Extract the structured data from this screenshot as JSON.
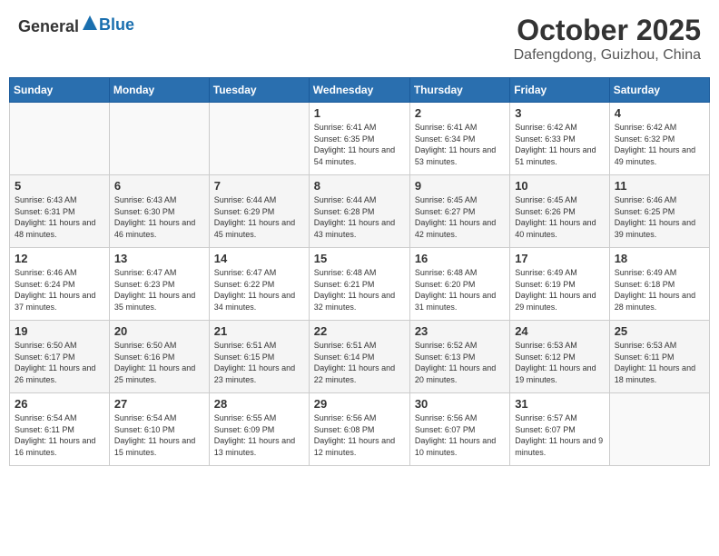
{
  "header": {
    "logo_general": "General",
    "logo_blue": "Blue",
    "month": "October 2025",
    "location": "Dafengdong, Guizhou, China"
  },
  "weekdays": [
    "Sunday",
    "Monday",
    "Tuesday",
    "Wednesday",
    "Thursday",
    "Friday",
    "Saturday"
  ],
  "weeks": [
    [
      {
        "day": "",
        "info": ""
      },
      {
        "day": "",
        "info": ""
      },
      {
        "day": "",
        "info": ""
      },
      {
        "day": "1",
        "info": "Sunrise: 6:41 AM\nSunset: 6:35 PM\nDaylight: 11 hours\nand 54 minutes."
      },
      {
        "day": "2",
        "info": "Sunrise: 6:41 AM\nSunset: 6:34 PM\nDaylight: 11 hours\nand 53 minutes."
      },
      {
        "day": "3",
        "info": "Sunrise: 6:42 AM\nSunset: 6:33 PM\nDaylight: 11 hours\nand 51 minutes."
      },
      {
        "day": "4",
        "info": "Sunrise: 6:42 AM\nSunset: 6:32 PM\nDaylight: 11 hours\nand 49 minutes."
      }
    ],
    [
      {
        "day": "5",
        "info": "Sunrise: 6:43 AM\nSunset: 6:31 PM\nDaylight: 11 hours\nand 48 minutes."
      },
      {
        "day": "6",
        "info": "Sunrise: 6:43 AM\nSunset: 6:30 PM\nDaylight: 11 hours\nand 46 minutes."
      },
      {
        "day": "7",
        "info": "Sunrise: 6:44 AM\nSunset: 6:29 PM\nDaylight: 11 hours\nand 45 minutes."
      },
      {
        "day": "8",
        "info": "Sunrise: 6:44 AM\nSunset: 6:28 PM\nDaylight: 11 hours\nand 43 minutes."
      },
      {
        "day": "9",
        "info": "Sunrise: 6:45 AM\nSunset: 6:27 PM\nDaylight: 11 hours\nand 42 minutes."
      },
      {
        "day": "10",
        "info": "Sunrise: 6:45 AM\nSunset: 6:26 PM\nDaylight: 11 hours\nand 40 minutes."
      },
      {
        "day": "11",
        "info": "Sunrise: 6:46 AM\nSunset: 6:25 PM\nDaylight: 11 hours\nand 39 minutes."
      }
    ],
    [
      {
        "day": "12",
        "info": "Sunrise: 6:46 AM\nSunset: 6:24 PM\nDaylight: 11 hours\nand 37 minutes."
      },
      {
        "day": "13",
        "info": "Sunrise: 6:47 AM\nSunset: 6:23 PM\nDaylight: 11 hours\nand 35 minutes."
      },
      {
        "day": "14",
        "info": "Sunrise: 6:47 AM\nSunset: 6:22 PM\nDaylight: 11 hours\nand 34 minutes."
      },
      {
        "day": "15",
        "info": "Sunrise: 6:48 AM\nSunset: 6:21 PM\nDaylight: 11 hours\nand 32 minutes."
      },
      {
        "day": "16",
        "info": "Sunrise: 6:48 AM\nSunset: 6:20 PM\nDaylight: 11 hours\nand 31 minutes."
      },
      {
        "day": "17",
        "info": "Sunrise: 6:49 AM\nSunset: 6:19 PM\nDaylight: 11 hours\nand 29 minutes."
      },
      {
        "day": "18",
        "info": "Sunrise: 6:49 AM\nSunset: 6:18 PM\nDaylight: 11 hours\nand 28 minutes."
      }
    ],
    [
      {
        "day": "19",
        "info": "Sunrise: 6:50 AM\nSunset: 6:17 PM\nDaylight: 11 hours\nand 26 minutes."
      },
      {
        "day": "20",
        "info": "Sunrise: 6:50 AM\nSunset: 6:16 PM\nDaylight: 11 hours\nand 25 minutes."
      },
      {
        "day": "21",
        "info": "Sunrise: 6:51 AM\nSunset: 6:15 PM\nDaylight: 11 hours\nand 23 minutes."
      },
      {
        "day": "22",
        "info": "Sunrise: 6:51 AM\nSunset: 6:14 PM\nDaylight: 11 hours\nand 22 minutes."
      },
      {
        "day": "23",
        "info": "Sunrise: 6:52 AM\nSunset: 6:13 PM\nDaylight: 11 hours\nand 20 minutes."
      },
      {
        "day": "24",
        "info": "Sunrise: 6:53 AM\nSunset: 6:12 PM\nDaylight: 11 hours\nand 19 minutes."
      },
      {
        "day": "25",
        "info": "Sunrise: 6:53 AM\nSunset: 6:11 PM\nDaylight: 11 hours\nand 18 minutes."
      }
    ],
    [
      {
        "day": "26",
        "info": "Sunrise: 6:54 AM\nSunset: 6:11 PM\nDaylight: 11 hours\nand 16 minutes."
      },
      {
        "day": "27",
        "info": "Sunrise: 6:54 AM\nSunset: 6:10 PM\nDaylight: 11 hours\nand 15 minutes."
      },
      {
        "day": "28",
        "info": "Sunrise: 6:55 AM\nSunset: 6:09 PM\nDaylight: 11 hours\nand 13 minutes."
      },
      {
        "day": "29",
        "info": "Sunrise: 6:56 AM\nSunset: 6:08 PM\nDaylight: 11 hours\nand 12 minutes."
      },
      {
        "day": "30",
        "info": "Sunrise: 6:56 AM\nSunset: 6:07 PM\nDaylight: 11 hours\nand 10 minutes."
      },
      {
        "day": "31",
        "info": "Sunrise: 6:57 AM\nSunset: 6:07 PM\nDaylight: 11 hours\nand 9 minutes."
      },
      {
        "day": "",
        "info": ""
      }
    ]
  ]
}
